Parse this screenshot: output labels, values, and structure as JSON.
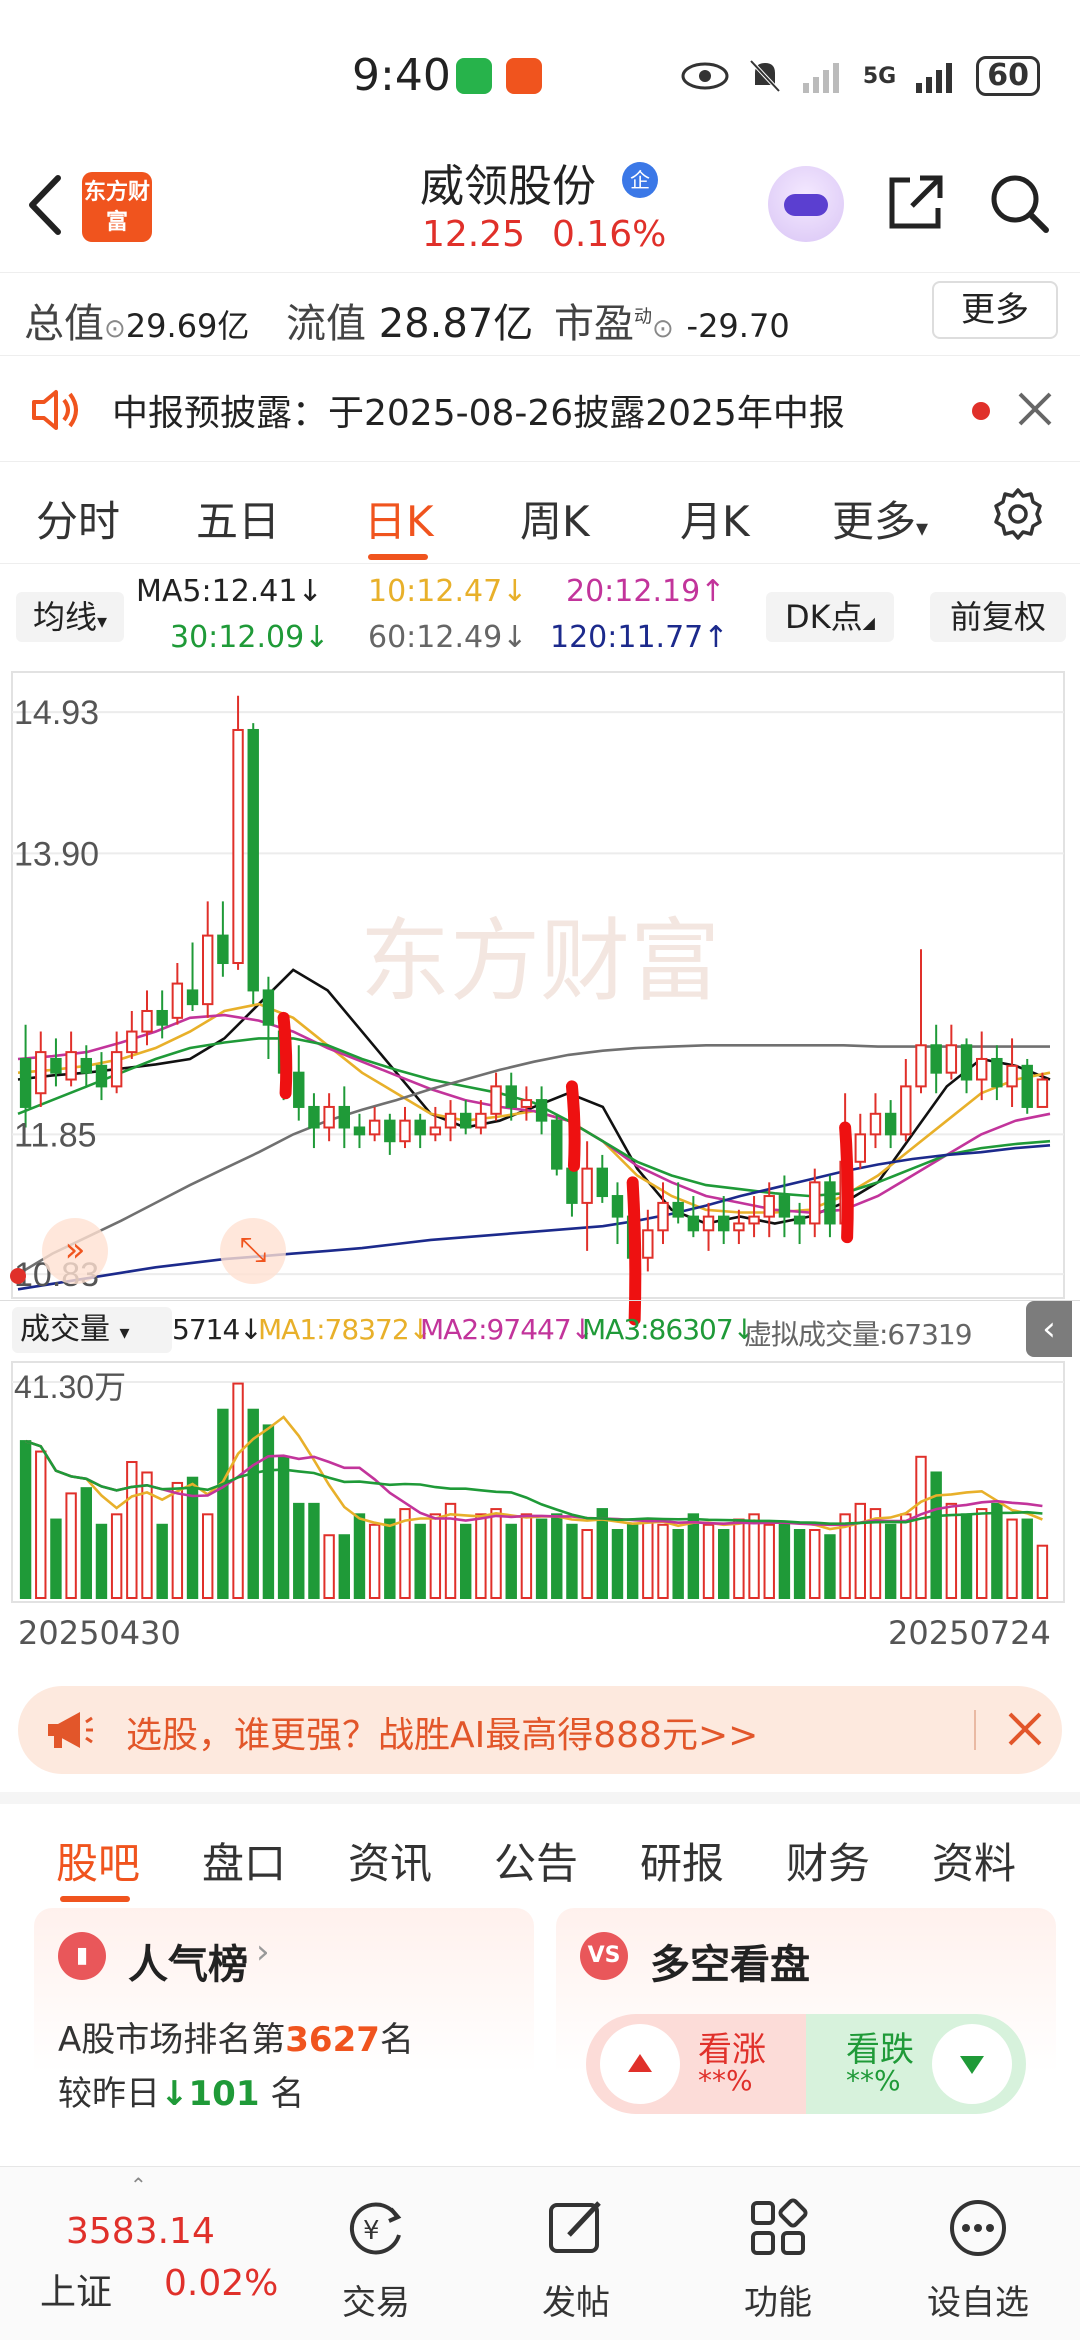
{
  "status_bar": {
    "time": "9:40",
    "network": "5G",
    "battery": "60"
  },
  "header": {
    "logo": "东方财富",
    "stock_name": "威领股份",
    "badge": "企",
    "price": "12.25",
    "change_pct": "0.16%"
  },
  "quote": {
    "total_label": "总值",
    "total_value": "29.69亿",
    "float_label": "流值",
    "float_value": "28.87亿",
    "pe_label": "市盈",
    "pe_sup": "动",
    "pe_value": "-29.70",
    "more": "更多"
  },
  "notice": {
    "text": "中报预披露：于2025-08-26披露2025年中报"
  },
  "period_tabs": [
    "分时",
    "五日",
    "日K",
    "周K",
    "月K",
    "更多"
  ],
  "ma": {
    "button": "均线",
    "ma5": "MA5:12.41↓",
    "ma10": "10:12.47↓",
    "ma20": "20:12.19↑",
    "ma30": "30:12.09↓",
    "ma60": "60:12.49↓",
    "ma120": "120:11.77↑",
    "dk": "DK点",
    "adjust": "前复权"
  },
  "colors": {
    "accent": "#f0541e",
    "up": "#e0302a",
    "down": "#1f9a38",
    "ma5": "#111111",
    "ma10": "#e8b02a",
    "ma20": "#c2349b",
    "ma30": "#1f9a38",
    "ma60": "#707070",
    "ma120": "#1c2a8c"
  },
  "chart_data": {
    "type": "candlestick",
    "price_ticks": [
      "14.93",
      "13.90",
      "11.85",
      "10.83"
    ],
    "candles": [
      [
        12.4,
        12.05,
        12.65,
        11.9
      ],
      [
        12.15,
        12.45,
        12.6,
        12.05
      ],
      [
        12.4,
        12.3,
        12.55,
        12.2
      ],
      [
        12.25,
        12.45,
        12.6,
        12.2
      ],
      [
        12.4,
        12.3,
        12.5,
        12.2
      ],
      [
        12.35,
        12.2,
        12.45,
        12.1
      ],
      [
        12.2,
        12.45,
        12.6,
        12.15
      ],
      [
        12.45,
        12.6,
        12.75,
        12.4
      ],
      [
        12.6,
        12.75,
        12.9,
        12.5
      ],
      [
        12.75,
        12.65,
        12.9,
        12.55
      ],
      [
        12.7,
        12.95,
        13.1,
        12.65
      ],
      [
        12.9,
        12.8,
        13.25,
        12.75
      ],
      [
        12.8,
        13.3,
        13.55,
        12.7
      ],
      [
        13.3,
        13.1,
        13.55,
        13.0
      ],
      [
        13.1,
        14.8,
        15.05,
        13.05
      ],
      [
        14.8,
        12.9,
        14.85,
        12.8
      ],
      [
        12.9,
        12.65,
        13.0,
        12.4
      ],
      [
        12.6,
        12.3,
        12.7,
        12.1
      ],
      [
        12.3,
        12.05,
        12.5,
        11.95
      ],
      [
        12.05,
        11.9,
        12.15,
        11.75
      ],
      [
        11.9,
        12.05,
        12.15,
        11.8
      ],
      [
        12.05,
        11.9,
        12.2,
        11.75
      ],
      [
        11.9,
        11.85,
        12.0,
        11.75
      ],
      [
        11.85,
        11.95,
        12.05,
        11.8
      ],
      [
        11.95,
        11.8,
        12.0,
        11.7
      ],
      [
        11.8,
        11.95,
        12.05,
        11.75
      ],
      [
        11.95,
        11.85,
        12.0,
        11.75
      ],
      [
        11.85,
        11.9,
        12.05,
        11.8
      ],
      [
        11.9,
        12.0,
        12.1,
        11.8
      ],
      [
        12.0,
        11.9,
        12.1,
        11.85
      ],
      [
        11.9,
        12.0,
        12.1,
        11.85
      ],
      [
        12.0,
        12.2,
        12.3,
        11.95
      ],
      [
        12.2,
        12.05,
        12.3,
        11.95
      ],
      [
        12.05,
        12.1,
        12.2,
        11.95
      ],
      [
        12.1,
        11.95,
        12.2,
        11.85
      ],
      [
        11.95,
        11.6,
        12.0,
        11.55
      ],
      [
        11.6,
        11.35,
        11.75,
        11.25
      ],
      [
        11.35,
        11.6,
        11.8,
        11.0
      ],
      [
        11.6,
        11.4,
        11.7,
        11.35
      ],
      [
        11.4,
        11.25,
        11.5,
        11.05
      ],
      [
        11.25,
        10.95,
        11.3,
        10.9
      ],
      [
        10.95,
        11.15,
        11.3,
        10.85
      ],
      [
        11.15,
        11.35,
        11.5,
        11.05
      ],
      [
        11.35,
        11.25,
        11.5,
        11.2
      ],
      [
        11.25,
        11.15,
        11.4,
        11.1
      ],
      [
        11.15,
        11.25,
        11.35,
        11.0
      ],
      [
        11.25,
        11.15,
        11.4,
        11.05
      ],
      [
        11.15,
        11.2,
        11.3,
        11.05
      ],
      [
        11.2,
        11.25,
        11.4,
        11.1
      ],
      [
        11.25,
        11.4,
        11.5,
        11.1
      ],
      [
        11.4,
        11.25,
        11.55,
        11.1
      ],
      [
        11.25,
        11.2,
        11.35,
        11.05
      ],
      [
        11.2,
        11.5,
        11.6,
        11.1
      ],
      [
        11.5,
        11.2,
        11.55,
        11.1
      ],
      [
        11.2,
        11.65,
        12.15,
        11.15
      ],
      [
        11.65,
        11.85,
        12.0,
        11.6
      ],
      [
        11.85,
        12.0,
        12.15,
        11.75
      ],
      [
        12.0,
        11.85,
        12.1,
        11.75
      ],
      [
        11.85,
        12.2,
        12.4,
        11.8
      ],
      [
        12.2,
        12.5,
        13.2,
        12.15
      ],
      [
        12.5,
        12.3,
        12.65,
        12.15
      ],
      [
        12.3,
        12.5,
        12.65,
        12.25
      ],
      [
        12.5,
        12.25,
        12.55,
        12.15
      ],
      [
        12.25,
        12.4,
        12.6,
        12.1
      ],
      [
        12.4,
        12.2,
        12.5,
        12.1
      ],
      [
        12.2,
        12.35,
        12.55,
        12.05
      ],
      [
        12.35,
        12.05,
        12.4,
        12.0
      ],
      [
        12.05,
        12.25,
        12.3,
        12.05
      ]
    ],
    "ma_lines": {
      "MA5": [
        12.25,
        12.28,
        12.3,
        12.33,
        12.36,
        12.4,
        12.55,
        12.8,
        13.05,
        12.9,
        12.6,
        12.3,
        12.0,
        11.9,
        11.95,
        12.05,
        12.15,
        12.05,
        11.6,
        11.3,
        11.2,
        11.25,
        11.2,
        11.25,
        11.35,
        11.5,
        11.85,
        12.2,
        12.4,
        12.35,
        12.25
      ],
      "MA10": [
        12.3,
        12.32,
        12.35,
        12.4,
        12.48,
        12.6,
        12.75,
        12.8,
        12.7,
        12.5,
        12.3,
        12.15,
        12.0,
        11.95,
        11.98,
        12.02,
        11.95,
        11.8,
        11.55,
        11.4,
        11.3,
        11.28,
        11.28,
        11.3,
        11.4,
        11.55,
        11.75,
        11.95,
        12.15,
        12.25,
        12.3
      ],
      "MA20": [
        12.4,
        12.42,
        12.45,
        12.52,
        12.6,
        12.7,
        12.72,
        12.68,
        12.6,
        12.48,
        12.38,
        12.28,
        12.18,
        12.1,
        12.05,
        12.02,
        11.95,
        11.8,
        11.62,
        11.5,
        11.4,
        11.35,
        11.3,
        11.28,
        11.3,
        11.4,
        11.55,
        11.7,
        11.85,
        11.95,
        12.0
      ],
      "MA30": [
        12.0,
        12.1,
        12.2,
        12.3,
        12.4,
        12.48,
        12.52,
        12.55,
        12.55,
        12.5,
        12.4,
        12.32,
        12.25,
        12.2,
        12.15,
        12.08,
        11.95,
        11.8,
        11.65,
        11.55,
        11.48,
        11.45,
        11.42,
        11.4,
        11.42,
        11.5,
        11.6,
        11.7,
        11.75,
        11.78,
        11.8
      ],
      "MA60": [
        10.83,
        10.98,
        11.1,
        11.22,
        11.35,
        11.48,
        11.6,
        11.72,
        11.85,
        11.95,
        12.03,
        12.1,
        12.18,
        12.25,
        12.32,
        12.38,
        12.43,
        12.46,
        12.48,
        12.49,
        12.5,
        12.5,
        12.5,
        12.5,
        12.5,
        12.49,
        12.49,
        12.49,
        12.49,
        12.49,
        12.49
      ],
      "MA120": [
        10.72,
        10.76,
        10.8,
        10.84,
        10.88,
        10.91,
        10.94,
        10.96,
        10.98,
        11.0,
        11.02,
        11.05,
        11.08,
        11.1,
        11.12,
        11.14,
        11.16,
        11.18,
        11.22,
        11.27,
        11.33,
        11.4,
        11.46,
        11.52,
        11.58,
        11.63,
        11.67,
        11.7,
        11.72,
        11.75,
        11.77
      ]
    },
    "volume_tick": "41.30万",
    "volumes": [
      30,
      28,
      15,
      20,
      21,
      14,
      16,
      26,
      24,
      14,
      22,
      23,
      16,
      36,
      41,
      36,
      33,
      27,
      18,
      18,
      12,
      12,
      16,
      14,
      15,
      17,
      14,
      16,
      18,
      14,
      16,
      17,
      14,
      16,
      15,
      16,
      14,
      13,
      17,
      13,
      14,
      15,
      14,
      13,
      16,
      14,
      13,
      15,
      16,
      14,
      14,
      13,
      13,
      12,
      16,
      18,
      17,
      14,
      16,
      27,
      24,
      18,
      16,
      17,
      18,
      15,
      15,
      10
    ],
    "x_start": "20250430",
    "x_end": "20250724"
  },
  "volume": {
    "button": "成交量",
    "v": "5714↓",
    "ma1": "MA1:78372↓",
    "ma2": "MA2:97447↓",
    "ma3": "MA3:86307↓",
    "virtual": "虚拟成交量:67319"
  },
  "promo": {
    "text": "选股，谁更强？战胜AI最高得888元>>"
  },
  "bottom_tabs": [
    "股吧",
    "盘口",
    "资讯",
    "公告",
    "研报",
    "财务",
    "资料"
  ],
  "popularity": {
    "title": "人气榜",
    "line1_pre": "A股市场排名第",
    "rank": "3627",
    "line1_post": "名",
    "line2_pre": "较昨日",
    "change": "101",
    "line2_post": "名"
  },
  "sentiment": {
    "badge": "VS",
    "title": "多空看盘",
    "up_label": "看涨",
    "up_pct": "**%",
    "down_label": "看跌",
    "down_pct": "**%"
  },
  "bottom_nav": {
    "index_value": "3583.14",
    "index_name": "上证",
    "index_pct": "0.02%",
    "trade": "交易",
    "post": "发帖",
    "function": "功能",
    "watchlist": "设自选"
  }
}
